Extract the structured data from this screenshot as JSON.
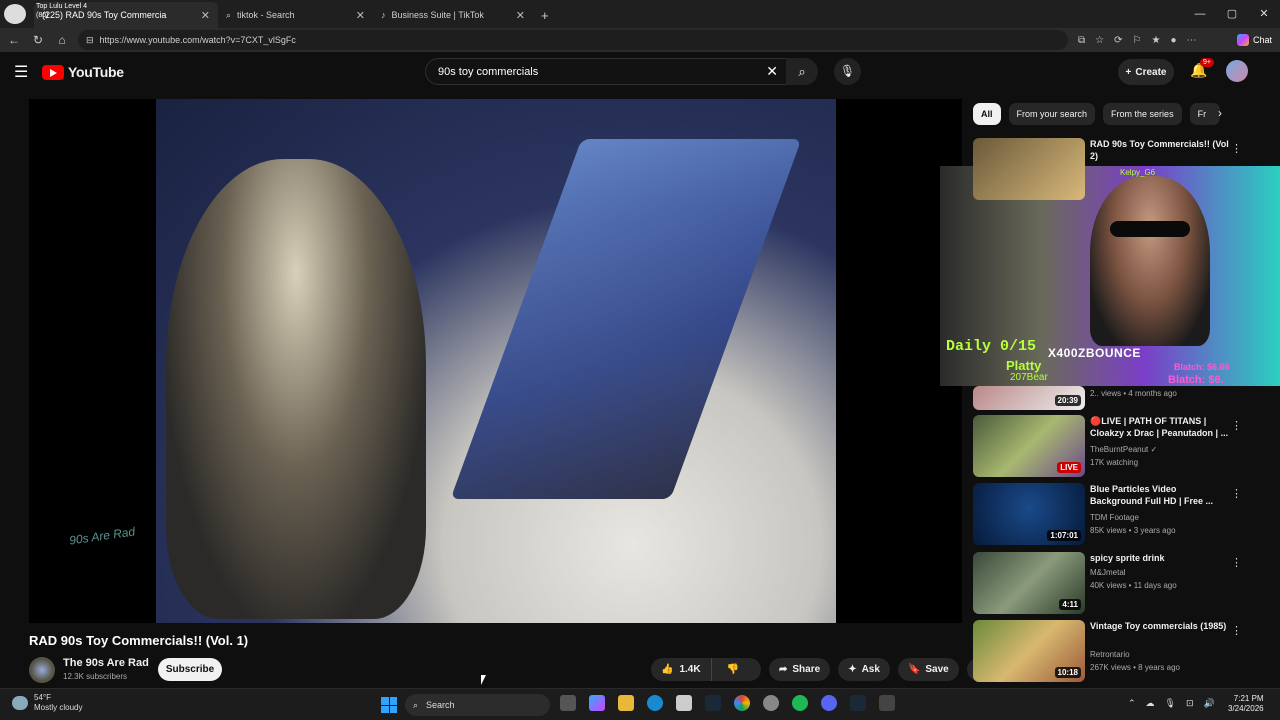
{
  "browser": {
    "tabs": [
      {
        "label": "(225) RAD 90s Toy Commercia",
        "overlay": "Top Lulu Level 4 (86)",
        "active": true
      },
      {
        "label": "tiktok - Search",
        "active": false
      },
      {
        "label": "Business Suite | TikTok",
        "active": false
      }
    ],
    "url": "https://www.youtube.com/watch?v=7CXT_vlSgFc",
    "chat_label": "Chat"
  },
  "youtube": {
    "logo": "YouTube",
    "search_value": "90s toy commercials",
    "create_label": "Create",
    "notif_badge": "9+"
  },
  "video": {
    "title": "RAD 90s Toy Commercials!! (Vol. 1)",
    "channel": "The 90s Are Rad",
    "subscribers": "12.3K subscribers",
    "subscribe_label": "Subscribe",
    "likes": "1.4K",
    "share_label": "Share",
    "ask_label": "Ask",
    "save_label": "Save",
    "watermark": "90s Are Rad"
  },
  "stream_overlay": {
    "daily": "Daily 0/15",
    "streamer": "X400ZBOUNCE",
    "platty": "Platty",
    "bear": "207Bear",
    "cam_name": "Kelpy_G6",
    "blatch1": "Blatch: $6.66",
    "blatch2": "Blatch: $6."
  },
  "chips": [
    "All",
    "From your search",
    "From the series",
    "Fr"
  ],
  "recommendations": [
    {
      "title": "RAD 90s Toy Commercials!! (Vol 2)",
      "channel": "",
      "meta": "",
      "duration": ""
    },
    {
      "title": "",
      "channel": "",
      "meta": "2.. views • 4 months ago",
      "duration": "20:39"
    },
    {
      "title": "🔴LIVE | PATH OF TITANS | Cloakzy x Drac | Peanutadon | ...",
      "channel": "TheBurntPeanut ✓",
      "meta": "17K watching",
      "duration": "LIVE"
    },
    {
      "title": "Blue Particles Video Background Full HD | Free ...",
      "channel": "TDM Footage",
      "meta": "85K views • 3 years ago",
      "duration": "1:07:01"
    },
    {
      "title": "spicy sprite drink",
      "channel": "M&Jmetal",
      "meta": "40K views • 11 days ago",
      "duration": "4:11"
    },
    {
      "title": "Vintage Toy commercials (1985)",
      "channel": "Retrontario",
      "meta": "267K views • 8 years ago",
      "duration": "10:18"
    }
  ],
  "taskbar": {
    "temp": "54°F",
    "weather": "Mostly cloudy",
    "search_label": "Search",
    "time": "7:21 PM",
    "date": "3/24/2026"
  },
  "colors": {
    "accent": "#ff0000",
    "bg": "#0f0f0f",
    "overlay_green": "#b6ff3a"
  }
}
